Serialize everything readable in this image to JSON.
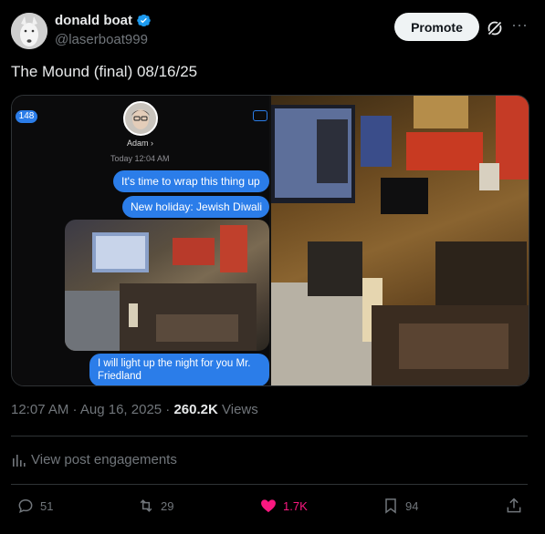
{
  "author": {
    "name": "donald boat",
    "handle": "@laserboat999"
  },
  "header": {
    "promote_label": "Promote",
    "more_label": "···"
  },
  "tweet": {
    "text": "The Mound (final) 08/16/25"
  },
  "screenshot": {
    "badge": "148",
    "contact_name": "Adam ›",
    "timestamp": "Today 12:04 AM",
    "messages": [
      "It's time to wrap this thing up",
      "New holiday: Jewish Diwali",
      "I will light up the night for you Mr. Friedland"
    ]
  },
  "meta": {
    "time": "12:07 AM · Aug 16, 2025 · ",
    "views_count": "260.2K",
    "views_label": " Views"
  },
  "engagements_label": "View post engagements",
  "actions": {
    "replies": "51",
    "reposts": "29",
    "likes": "1.7K",
    "bookmarks": "94"
  },
  "colors": {
    "accent": "#1d9bf0",
    "like": "#f91880",
    "imessage_blue": "#2b7de9"
  }
}
